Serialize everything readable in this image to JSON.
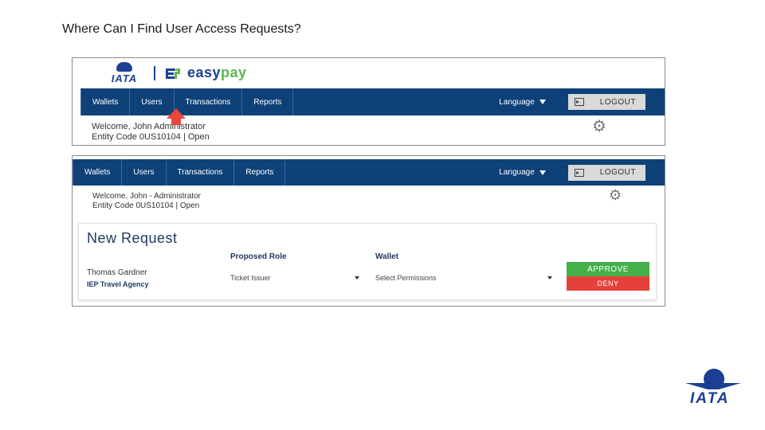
{
  "slide": {
    "title": "Where Can I Find User Access Requests?"
  },
  "colors": {
    "nav_bg": "#0e4178",
    "brand_blue": "#1c3f94",
    "brand_green": "#5bb94e",
    "approve": "#43b049",
    "deny": "#e5413b",
    "arrow": "#e8463d"
  },
  "header": {
    "iata_wordmark": "IATA",
    "brand_easy": "easy",
    "brand_pay": "pay"
  },
  "nav": {
    "items": [
      "Wallets",
      "Users",
      "Transactions",
      "Reports"
    ],
    "language": "Language",
    "logout": "LOGOUT"
  },
  "welcome": {
    "line1_shot1": "Welcome, John   Administrator",
    "line2_shot1": "Entity Code 0US10104 | Open",
    "line1_shot2": "Welcome, John - Administrator",
    "line2_shot2": "Entity Code 0US10104 | Open"
  },
  "request": {
    "title": "New Request",
    "col_role": "Proposed Role",
    "col_wallet": "Wallet",
    "user_name": "Thomas Gardner",
    "agency": "IEP Travel Agency",
    "role_value": "Ticket Issuer",
    "wallet_value": "Select Permissions",
    "approve_label": "APPROVE",
    "deny_label": "DENY"
  },
  "footer_logo": {
    "wordmark": "IATA"
  }
}
